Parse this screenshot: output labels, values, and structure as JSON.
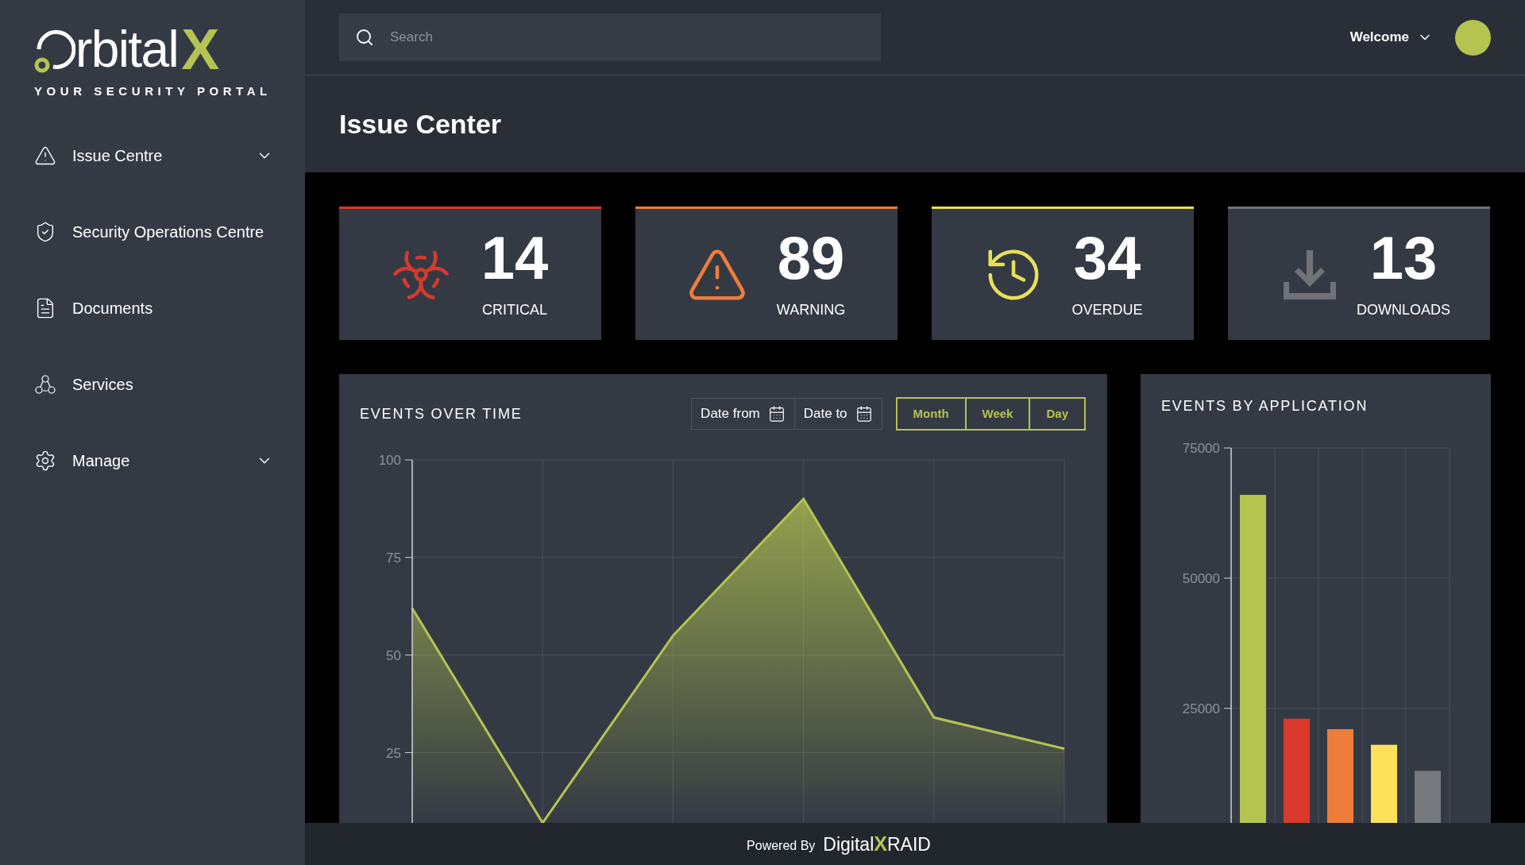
{
  "sidebar": {
    "logo": {
      "wordmark": "rbital",
      "mark": "X",
      "tagline": "YOUR SECURITY PORTAL"
    },
    "items": [
      {
        "label": "Issue Centre",
        "kind": "alert",
        "expandable": true
      },
      {
        "label": "Security Operations Centre",
        "kind": "shield",
        "expandable": false
      },
      {
        "label": "Documents",
        "kind": "document",
        "expandable": false
      },
      {
        "label": "Services",
        "kind": "services",
        "expandable": false
      },
      {
        "label": "Manage",
        "kind": "settings",
        "expandable": true
      }
    ]
  },
  "header": {
    "search": {
      "placeholder": "Search"
    },
    "user_menu": {
      "label": "Welcome"
    }
  },
  "page_title": "Issue Center",
  "stats": [
    {
      "value": "14",
      "label": "CRITICAL",
      "kind": "biohazard",
      "color": "#d8392b"
    },
    {
      "value": "89",
      "label": "WARNING",
      "kind": "warning",
      "color": "#ee7d3b"
    },
    {
      "value": "34",
      "label": "OVERDUE",
      "kind": "overdue",
      "color": "#e8e05a"
    },
    {
      "value": "13",
      "label": "DOWNLOADS",
      "kind": "download",
      "color": "#6f7378"
    }
  ],
  "events_over_time": {
    "title": "EVENTS OVER TIME",
    "date_filters": [
      {
        "label": "Date from"
      },
      {
        "label": "Date to"
      }
    ],
    "ranges": [
      {
        "label": "Month"
      },
      {
        "label": "Week"
      },
      {
        "label": "Day"
      }
    ],
    "chart_data": {
      "type": "area",
      "grid": true,
      "ylim": [
        7,
        100
      ],
      "yticks": [
        25,
        50,
        75,
        100
      ],
      "series": [
        {
          "color": "#b5c451",
          "values": [
            62,
            7,
            55,
            90,
            34,
            26
          ]
        }
      ]
    }
  },
  "events_by_application": {
    "title": "EVENTS BY APPLICATION",
    "chart_data": {
      "type": "bar",
      "grid": true,
      "ylim": [
        3000,
        75000
      ],
      "yticks": [
        25000,
        50000,
        75000
      ],
      "series": [
        {
          "color": "#b5c451",
          "values": [
            66000
          ]
        },
        {
          "color": "#d8392b",
          "values": [
            23000
          ]
        },
        {
          "color": "#ee7d3b",
          "values": [
            21000
          ]
        },
        {
          "color": "#fbe15c",
          "values": [
            18000
          ]
        },
        {
          "color": "#75787c",
          "values": [
            13000
          ]
        }
      ]
    }
  },
  "footer": {
    "prefix": "Powered By",
    "brand": "Digital",
    "brand_mark": "X",
    "brand_suffix": "RAID"
  }
}
